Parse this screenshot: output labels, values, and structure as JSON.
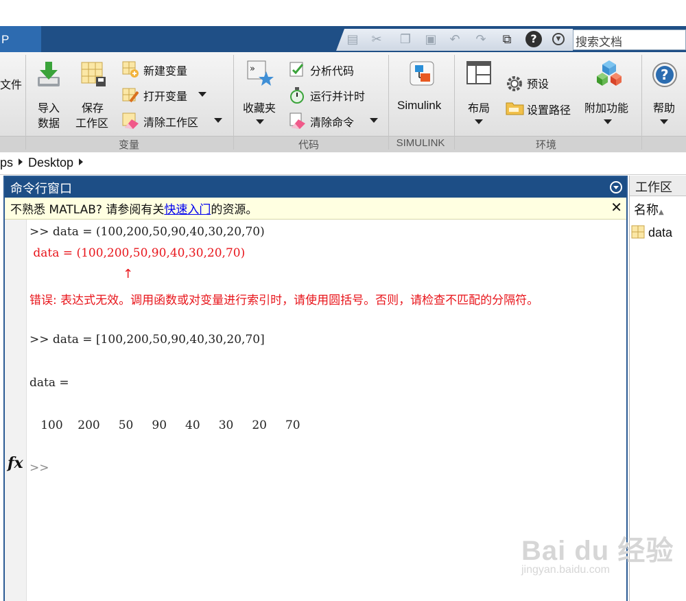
{
  "app": {
    "home_tab_partial": "P",
    "search_placeholder": "搜索文档"
  },
  "quick_access": {
    "icons": [
      "save-icon",
      "cut-icon",
      "copy-icon",
      "paste-icon",
      "undo-icon",
      "redo-icon",
      "switch-windows-icon",
      "help-icon",
      "minimize-ribbon-icon"
    ],
    "help_glyph": "?"
  },
  "ribbon": {
    "partial_file_label": "文件",
    "import": {
      "line1": "导入",
      "line2": "数据"
    },
    "save_workspace": {
      "line1": "保存",
      "line2": "工作区"
    },
    "new_variable": "新建变量",
    "open_variable": "打开变量",
    "clear_workspace": "清除工作区",
    "favorites": "收藏夹",
    "analyze_code": "分析代码",
    "run_and_time": "运行并计时",
    "clear_commands": "清除命令",
    "simulink": "Simulink",
    "layout": "布局",
    "preferences": "预设",
    "set_path": "设置路径",
    "addons": "附加功能",
    "help": "帮助",
    "groups": {
      "variable": "变量",
      "code": "代码",
      "simulink": "SIMULINK",
      "environment": "环境"
    }
  },
  "address": {
    "segments": [
      "ps",
      "Desktop"
    ]
  },
  "command_window": {
    "title": "命令行窗口",
    "notice": {
      "before": "不熟悉 MATLAB? 请参阅有关",
      "link": "快速入门",
      "after": "的资源。"
    },
    "lines": [
      {
        "text": ">> data = (100,200,50,90,40,30,20,70)",
        "style": "normal"
      },
      {
        "text": " data = (100,200,50,90,40,30,20,70)",
        "style": "red"
      },
      {
        "text": "错误: 表达式无效。调用函数或对变量进行索引时，请使用圆括号。否则，请检查不匹配的分隔符。",
        "style": "error"
      },
      {
        "text": ">> data = [100,200,50,90,40,30,20,70]",
        "style": "normal"
      },
      {
        "text": "data =",
        "style": "normal"
      },
      {
        "text": "   100    200     50     90     40     30     20     70",
        "style": "normal"
      },
      {
        "text": ">>",
        "style": "prompt"
      }
    ],
    "error_marker": "↑",
    "fx_label": "fx"
  },
  "workspace": {
    "title": "工作区",
    "column_name": "名称",
    "sort_indicator": "▲",
    "variables": [
      "data"
    ]
  },
  "watermark": {
    "brand": "Bai du 经验",
    "url": "jingyan.baidu.com"
  },
  "colors": {
    "title_bar": "#1f4f86",
    "panel_header": "#1d4e86",
    "error_red": "#e8151b",
    "notice_bg": "#ffffe1",
    "link": "#0000ee"
  }
}
